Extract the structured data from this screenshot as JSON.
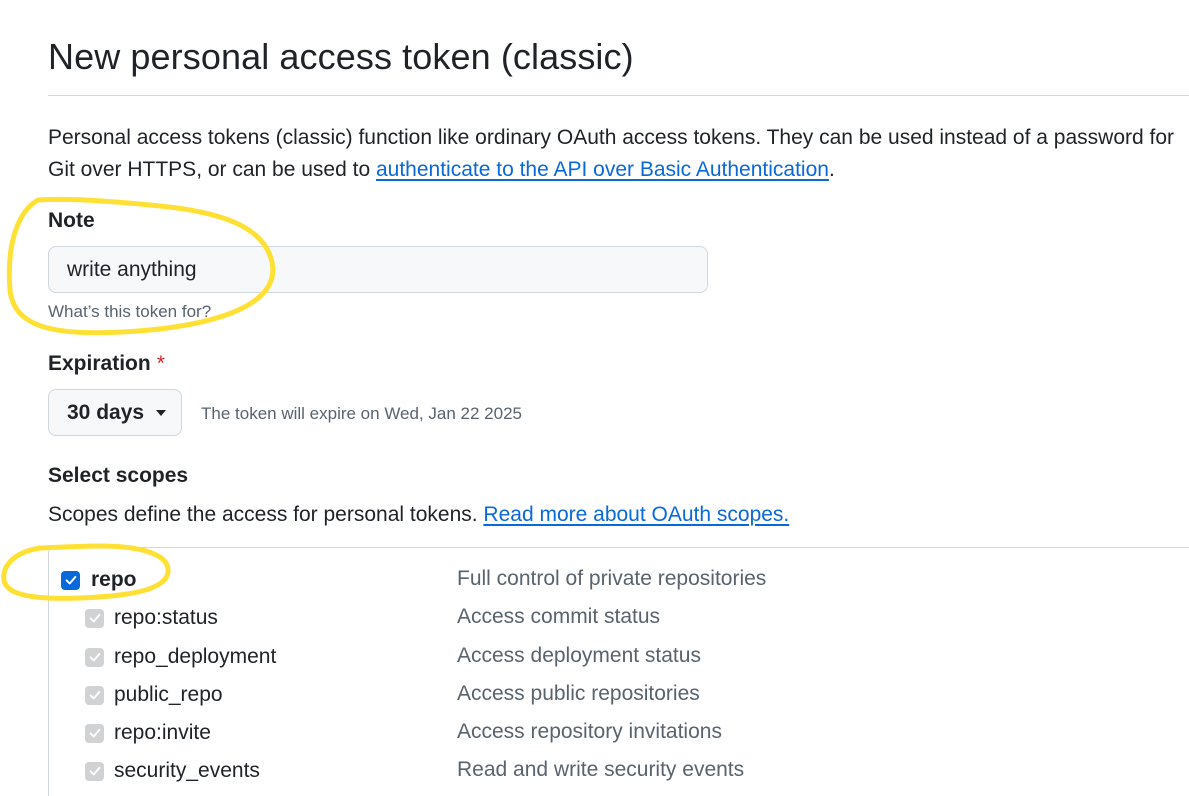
{
  "page": {
    "title": "New personal access token (classic)",
    "intro_text": "Personal access tokens (classic) function like ordinary OAuth access tokens. They can be used instead of a password for Git over HTTPS, or can be used to ",
    "intro_link": "authenticate to the API over Basic Authentication",
    "intro_end": "."
  },
  "note": {
    "label": "Note",
    "value": "write anything",
    "hint": "What’s this token for?"
  },
  "expiration": {
    "label": "Expiration",
    "required_mark": "*",
    "selected": "30 days",
    "note": "The token will expire on Wed, Jan 22 2025"
  },
  "scopes": {
    "label": "Select scopes",
    "description": "Scopes define the access for personal tokens. ",
    "link": "Read more about OAuth scopes.",
    "parent": {
      "name": "repo",
      "description": "Full control of private repositories",
      "checked": true
    },
    "children": [
      {
        "name": "repo:status",
        "description": "Access commit status"
      },
      {
        "name": "repo_deployment",
        "description": "Access deployment status"
      },
      {
        "name": "public_repo",
        "description": "Access public repositories"
      },
      {
        "name": "repo:invite",
        "description": "Access repository invitations"
      },
      {
        "name": "security_events",
        "description": "Read and write security events"
      }
    ]
  },
  "colors": {
    "link": "#0969da",
    "checkbox_checked": "#0969da",
    "checkbox_disabled": "#d0d2d4",
    "annotation": "#ffe135"
  }
}
